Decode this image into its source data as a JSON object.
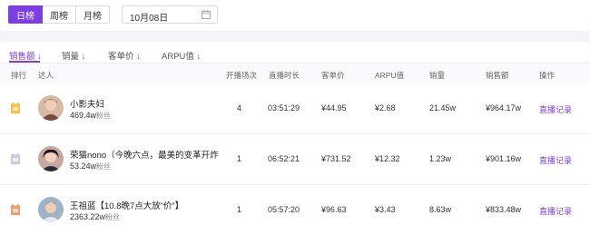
{
  "tabs": {
    "day": "日榜",
    "week": "周榜",
    "month": "月榜"
  },
  "date": {
    "value": "10月08日"
  },
  "sort_bar": [
    "销售额 ↓",
    "销量 ↓",
    "客单价 ↓",
    "ARPU值 ↓"
  ],
  "columns": {
    "rank": "排行",
    "talent": "达人",
    "sessions": "开播场次",
    "duration": "直播时长",
    "price": "客单价",
    "arpu": "ARPU值",
    "sales": "销量",
    "revenue": "销售额",
    "action": "操作"
  },
  "rows": [
    {
      "medal": "gold",
      "name": "小影夫妇",
      "fans": "469.4w",
      "fans_unit": "粉丝",
      "sessions": "4",
      "duration": "03:51:29",
      "price": "¥44.95",
      "arpu": "¥2.68",
      "sales": "21.45w",
      "revenue": "¥964.17w",
      "action": "直播记录"
    },
    {
      "medal": "silver",
      "name": "荣猫nono（今晚六点，最美的变革开炸",
      "fans": "53.24w",
      "fans_unit": "粉丝",
      "sessions": "1",
      "duration": "06:52:21",
      "price": "¥731.52",
      "arpu": "¥12.32",
      "sales": "1.23w",
      "revenue": "¥901.16w",
      "action": "直播记录"
    },
    {
      "medal": "bronze",
      "name": "王祖蓝【10.8晚7点大放“价”】",
      "fans": "2363.22w",
      "fans_unit": "粉丝",
      "sessions": "1",
      "duration": "05:57:20",
      "price": "¥96.63",
      "arpu": "¥3.43",
      "sales": "8.63w",
      "revenue": "¥833.48w",
      "action": "直播记录"
    }
  ],
  "colors": {
    "accent": "#7b3fe4",
    "gold": "#f2c14e",
    "silver": "#c9ccd6",
    "bronze": "#e0a27a"
  }
}
